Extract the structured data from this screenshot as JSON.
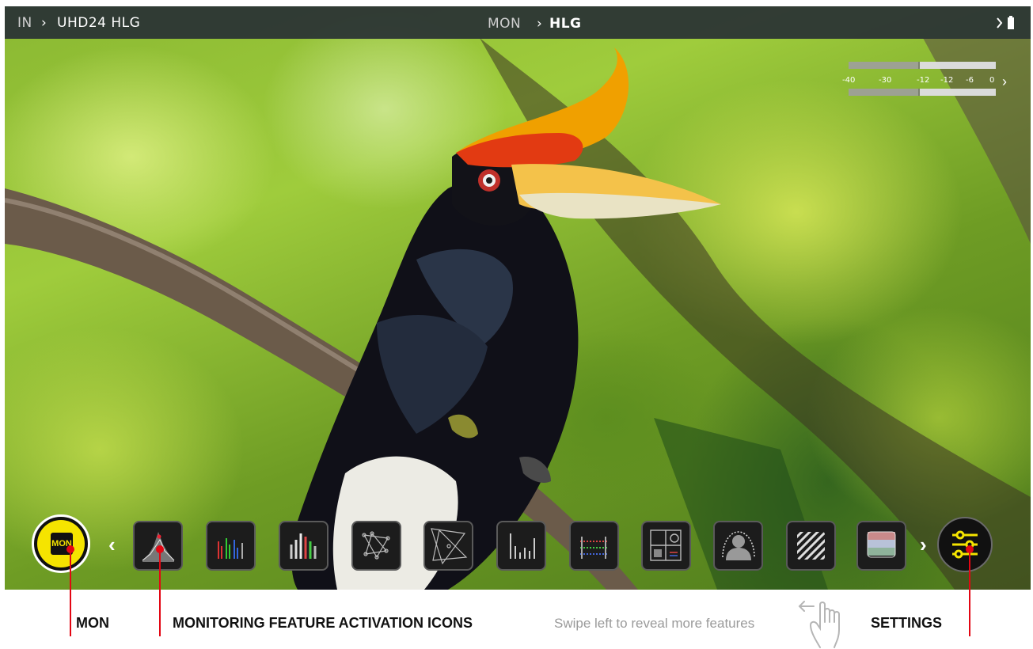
{
  "topbar": {
    "input_label": "IN",
    "input_value": "UHD24 HLG",
    "monitor_label": "MON",
    "monitor_value": "HLG",
    "chevron": "›"
  },
  "audio_meter": {
    "scale": [
      "-40",
      "-30",
      "-12",
      "-12",
      "-6",
      "0"
    ],
    "expand_icon": "chevron-right-icon"
  },
  "bottom_bar": {
    "mon_button_label": "MON",
    "prev_icon": "chevron-left-icon",
    "next_icon": "chevron-right-icon",
    "tools": [
      {
        "icon": "luma-histogram-icon"
      },
      {
        "icon": "rgb-parade-icon"
      },
      {
        "icon": "waveform-icon"
      },
      {
        "icon": "vectorscope-icon"
      },
      {
        "icon": "vectorscope-zoom-icon"
      },
      {
        "icon": "false-color-scale-icon"
      },
      {
        "icon": "rgb-levels-icon"
      },
      {
        "icon": "frame-guides-icon"
      },
      {
        "icon": "focus-peaking-icon"
      },
      {
        "icon": "zebra-icon"
      },
      {
        "icon": "false-color-icon"
      }
    ],
    "settings_icon": "settings-sliders-icon"
  },
  "annotations": {
    "mon": "MON",
    "features": "MONITORING FEATURE ACTIVATION ICONS",
    "hint": "Swipe left to reveal more features",
    "settings": "SETTINGS"
  },
  "colors": {
    "accent_yellow": "#f5e400",
    "annotation_red": "#e30613",
    "topbar_bg": "#283034"
  }
}
